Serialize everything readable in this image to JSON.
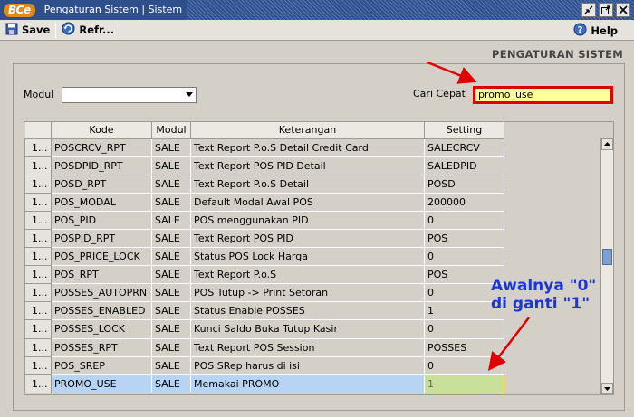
{
  "window": {
    "logo_text": "BCe",
    "title": "Pengaturan Sistem | Sistem"
  },
  "toolbar": {
    "save_label": "Save",
    "refresh_label": "Refr...",
    "help_label": "Help"
  },
  "page": {
    "heading": "PENGATURAN SISTEM"
  },
  "filters": {
    "modul_label": "Modul",
    "modul_value": "",
    "search_label": "Cari Cepat",
    "search_value": "promo_use"
  },
  "grid": {
    "columns": [
      "Kode",
      "Modul",
      "Keterangan",
      "Setting"
    ],
    "rows": [
      {
        "idx": "1...",
        "kode": "POSCRCV_RPT",
        "modul": "SALE",
        "ket": "Text Report P.o.S Detail Credit Card",
        "setting": "SALECRCV"
      },
      {
        "idx": "1...",
        "kode": "POSDPID_RPT",
        "modul": "SALE",
        "ket": "Text Report POS PID Detail",
        "setting": "SALEDPID"
      },
      {
        "idx": "1...",
        "kode": "POSD_RPT",
        "modul": "SALE",
        "ket": "Text Report P.o.S Detail",
        "setting": "POSD"
      },
      {
        "idx": "1...",
        "kode": "POS_MODAL",
        "modul": "SALE",
        "ket": "Default Modal Awal POS",
        "setting": "200000"
      },
      {
        "idx": "1...",
        "kode": "POS_PID",
        "modul": "SALE",
        "ket": "POS menggunakan PID",
        "setting": "0"
      },
      {
        "idx": "1...",
        "kode": "POSPID_RPT",
        "modul": "SALE",
        "ket": "Text Report POS PID",
        "setting": "POS"
      },
      {
        "idx": "1...",
        "kode": "POS_PRICE_LOCK",
        "modul": "SALE",
        "ket": "Status POS Lock Harga",
        "setting": "0"
      },
      {
        "idx": "1...",
        "kode": "POS_RPT",
        "modul": "SALE",
        "ket": "Text Report P.o.S",
        "setting": "POS"
      },
      {
        "idx": "1...",
        "kode": "POSSES_AUTOPRN",
        "modul": "SALE",
        "ket": "POS Tutup -> Print Setoran",
        "setting": "0"
      },
      {
        "idx": "1...",
        "kode": "POSSES_ENABLED",
        "modul": "SALE",
        "ket": "Status Enable POSSES",
        "setting": "1"
      },
      {
        "idx": "1...",
        "kode": "POSSES_LOCK",
        "modul": "SALE",
        "ket": "Kunci Saldo Buka Tutup Kasir",
        "setting": "0"
      },
      {
        "idx": "1...",
        "kode": "POSSES_RPT",
        "modul": "SALE",
        "ket": "Text Report POS Session",
        "setting": "POSSES"
      },
      {
        "idx": "1...",
        "kode": "POS_SREP",
        "modul": "SALE",
        "ket": "POS SRep harus di isi",
        "setting": "0"
      },
      {
        "idx": "1...",
        "kode": "PROMO_USE",
        "modul": "SALE",
        "ket": "Memakai PROMO",
        "setting": "1",
        "selected": true
      }
    ]
  },
  "annotation": {
    "line1": "Awalnya \"0\"",
    "line2": "di ganti \"1\"",
    "color": "#1a35d8",
    "arrow_color": "#e00000"
  },
  "icons": {
    "save": "save-icon",
    "refresh": "refresh-icon",
    "help": "help-icon"
  }
}
